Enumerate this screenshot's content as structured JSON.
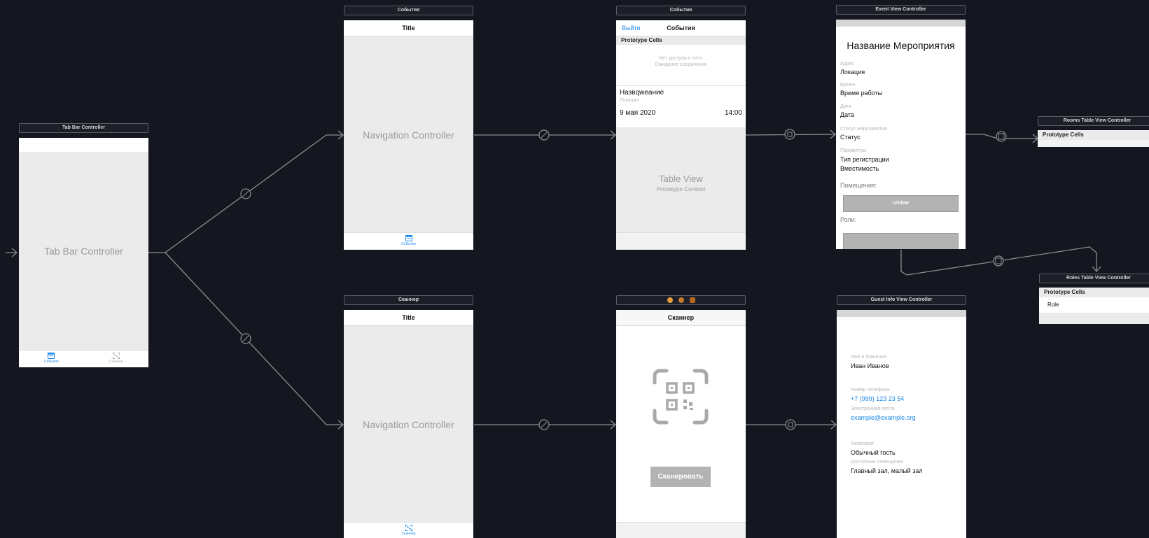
{
  "tab_bar_scene": {
    "title": "Tab Bar Controller",
    "label": "Tab Bar Controller",
    "tabs": [
      {
        "label": "События",
        "icon": "calendar-icon",
        "color": "#1d8ae8"
      },
      {
        "label": "Сканнер",
        "icon": "qr-scan-icon",
        "color": "#b0b0b0"
      }
    ]
  },
  "events_nav_scene": {
    "title": "События",
    "nav_title": "Title",
    "label": "Navigation Controller",
    "tab_label": "События"
  },
  "events_table_scene": {
    "title": "События",
    "nav_left": "Выйти",
    "nav_title": "События",
    "section_header": "Prototype Cells",
    "no_network_line1": "Нет доступа к сети.",
    "no_network_line2": "Ожидание соединения",
    "cell_name": "Назвqweание",
    "cell_location": "Локация",
    "cell_date": "9 мая 2020",
    "cell_time": "14:00",
    "table_label": "Table View",
    "table_sublabel": "Prototype Content"
  },
  "event_view_scene": {
    "title": "Event View Controller",
    "event_name": "Название Мероприятия",
    "fields": [
      {
        "label": "Адрес",
        "value": "Локация"
      },
      {
        "label": "Время",
        "value": "Время работы"
      },
      {
        "label": "Дата",
        "value": "Дата"
      },
      {
        "label": "Статус мероприятия",
        "value": "Статус"
      },
      {
        "label": "Параметры",
        "value": "Тип регистрации",
        "value2": "Вместимость"
      }
    ],
    "rooms_label": "Помещения:",
    "uiview_label": "UIView",
    "roles_label": "Роли:"
  },
  "rooms_scene": {
    "title": "Rooms Table View Controller",
    "section_header": "Prototype Cells"
  },
  "roles_scene": {
    "title": "Roles Table View Controller",
    "section_header": "Prototype Cells",
    "cell": "Role"
  },
  "scanner_nav_scene": {
    "title": "Сканнер",
    "nav_title": "Title",
    "label": "Navigation Controller",
    "tab_label": "Сканнер"
  },
  "scanner_scene": {
    "nav_title": "Сканнер",
    "button_label": "Сканировать"
  },
  "guest_info_scene": {
    "title": "Guest Info View Controller",
    "name_label": "Имя и Фамилия",
    "name_value": "Иван Иванов",
    "phone_label": "Номер телефона",
    "phone_value": "+7 (999) 123 23 54",
    "email_label": "Электронная почта",
    "email_value": "example@example.org",
    "category_label": "Категория",
    "category_value": "Обычный гость",
    "rooms_label": "Доступные помещения",
    "rooms_value": "Главный зал, малый зал"
  },
  "colors": {
    "canvas_bg": "#14171f",
    "connection_line": "#8a8d94",
    "accent_blue": "#1d8ae8",
    "placeholder_gray": "#ebebeb"
  }
}
